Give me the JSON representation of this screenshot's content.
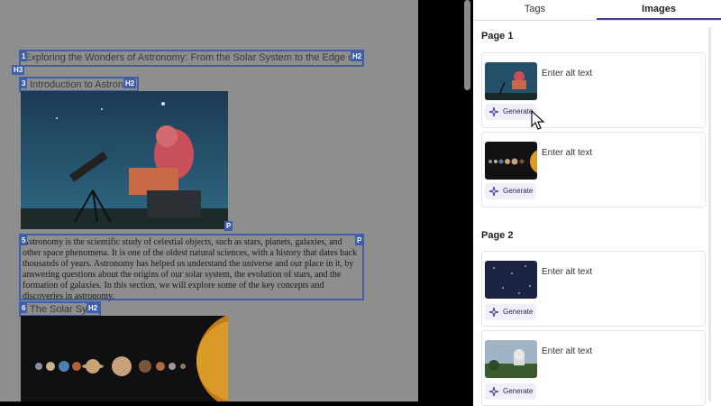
{
  "document": {
    "tags": {
      "h1_num": "1",
      "h1_tag": "H2",
      "h3_tag": "H3",
      "h2_num": "3",
      "h2_tag": "H2",
      "p_num": "5",
      "p_tag": "P",
      "p_small": "P",
      "h4_num": "6",
      "h4_tag": "H2"
    },
    "title": "Exploring the Wonders of Astronomy: From the Solar System to the Edge of the Universe",
    "intro_heading": "Introduction to Astronomy",
    "paragraph": "Astronomy is the scientific study of celestial objects, such as stars, planets, galaxies, and other space phenomena. It is one of the oldest natural sciences, with a history that dates back thousands of years. Astronomy has helped us understand the universe and our place in it, by answering questions about the origins of our solar system, the evolution of stars, and the formation of galaxies. In this section, we will explore some of the key concepts and discoveries in astronomy.",
    "solar_heading": "The Solar System"
  },
  "panel": {
    "tabs": [
      {
        "label": "Tags",
        "active": false
      },
      {
        "label": "Images",
        "active": true
      }
    ],
    "pages": [
      {
        "label": "Page 1",
        "images": [
          {
            "alt_placeholder": "Enter alt text",
            "generate_label": "Generate",
            "thumb": "telescope-person"
          },
          {
            "alt_placeholder": "Enter alt text",
            "generate_label": "Generate",
            "thumb": "planets-row"
          }
        ]
      },
      {
        "label": "Page 2",
        "images": [
          {
            "alt_placeholder": "Enter alt text",
            "generate_label": "Generate",
            "thumb": "starfield"
          },
          {
            "alt_placeholder": "Enter alt text",
            "generate_label": "Generate",
            "thumb": "observatory-landscape"
          }
        ]
      }
    ]
  },
  "colors": {
    "tag_blue": "#3f5fa8",
    "accent_purple": "#4a3b8f",
    "button_bg": "#f0eef7"
  },
  "icons": [
    "sparkle-icon",
    "mouse-cursor-icon"
  ]
}
